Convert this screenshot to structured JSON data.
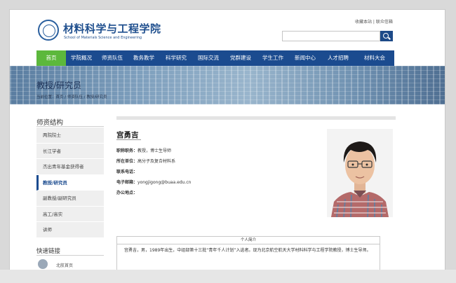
{
  "header": {
    "title_cn": "材料科学与工程学院",
    "title_en": "School of Materials Science and Engineering",
    "toplinks": "收藏本站 | 联众信箱",
    "search_placeholder": ""
  },
  "nav": {
    "items": [
      "首页",
      "学院概况",
      "师资队伍",
      "教务教学",
      "科学研究",
      "国际交流",
      "党群建设",
      "学生工作",
      "新闻中心",
      "人才招聘",
      "材料大会"
    ],
    "active_index": 0
  },
  "banner": {
    "title": "教授/研究员",
    "breadcrumb": "当前位置：首页 / 师资队伍 / 教授/研究员"
  },
  "sidebar": {
    "title": "师资结构",
    "items": [
      "两院院士",
      "长江学者",
      "杰出青年基金获得者",
      "教授/研究员",
      "副教授/副研究员",
      "高工/高实",
      "讲师"
    ],
    "active_index": 3,
    "quick_title": "快速链接",
    "quick_label": "北航首页"
  },
  "profile": {
    "name": "宫勇吉",
    "fields": [
      {
        "label": "职称职务：",
        "value": "教授，博士生导师"
      },
      {
        "label": "所在单位：",
        "value": "高分子及复合材料系"
      },
      {
        "label": "联系电话：",
        "value": ""
      },
      {
        "label": "电子邮箱：",
        "value": "yongjigong@buaa.edu.cn"
      },
      {
        "label": "办公地点：",
        "value": ""
      }
    ],
    "bio_heading": "个人简介",
    "bio_text": "宫勇吉，男，1989年出生，中组部第十三批“青年千人计划”入选者。现为北京航空航天大学材料科学与工程学院教授，博士生导师。"
  },
  "watermark": "",
  "colors": {
    "nav_blue": "#1b4b8f",
    "nav_active_green": "#5cb83c",
    "brand_blue": "#1f4f8e"
  }
}
